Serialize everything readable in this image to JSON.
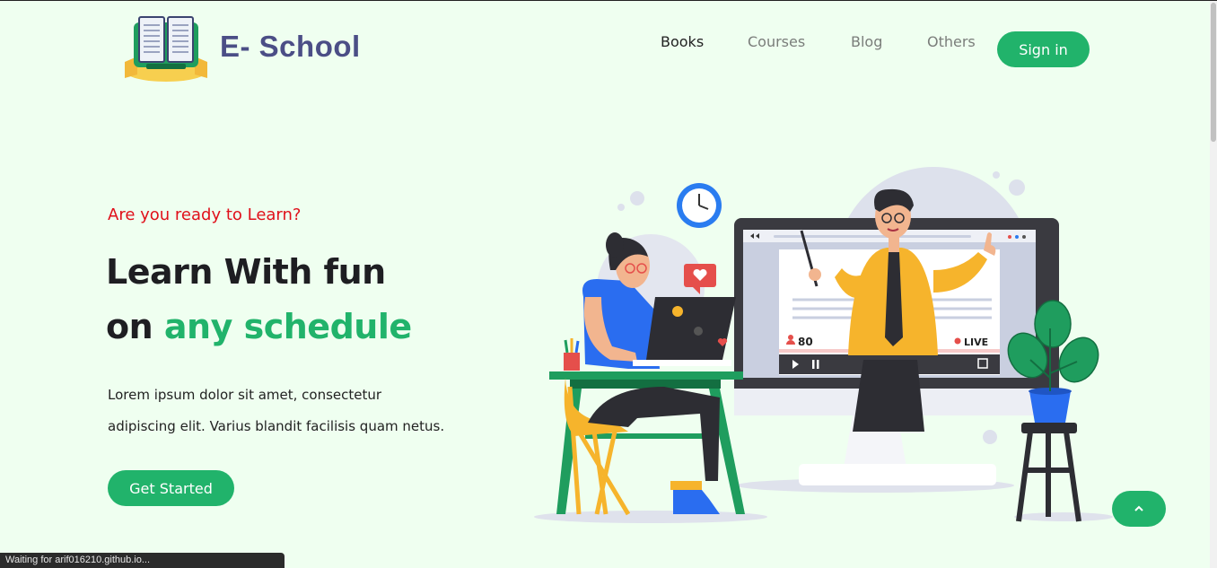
{
  "header": {
    "brand": "E- School",
    "nav": [
      "Books",
      "Courses",
      "Blog",
      "Others"
    ],
    "signin_label": "Sign in"
  },
  "hero": {
    "eyebrow": "Are you ready to Learn?",
    "title_line1": "Learn With fun",
    "title_line2_prefix": "on",
    "title_line2_highlight": "any schedule",
    "description_line1": "Lorem ipsum dolor sit amet, consectetur",
    "description_line2": "adipiscing elit. Varius blandit facilisis quam netus.",
    "cta_label": "Get Started",
    "illustration": {
      "viewer_count": "80",
      "live_label": "LIVE"
    }
  },
  "status_bar": "Waiting for arif016210.github.io...",
  "colors": {
    "background": "#effff0",
    "accent": "#21b36b",
    "eyebrow": "#e0101a",
    "brand": "#4b4e86"
  },
  "icons": {
    "logo": "open-book-logo",
    "scroll_top": "chevron-up-icon"
  }
}
